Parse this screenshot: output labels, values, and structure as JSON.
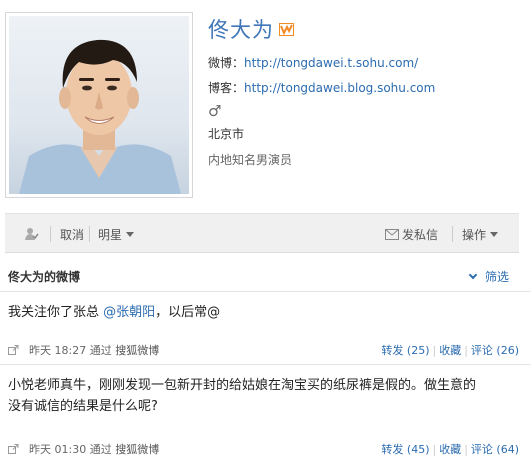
{
  "profile": {
    "name": "佟大为",
    "weibo_label": "微博：",
    "weibo_url": "http://tongdawei.t.sohu.com/",
    "blog_label": "博客：",
    "blog_url": "http://tongdawei.blog.sohu.com",
    "gender_symbol": "♂",
    "city": "北京市",
    "description": "内地知名男演员",
    "badge_color": "#f28c28"
  },
  "action_bar": {
    "unfollow_label": "取消",
    "group_label": "明星",
    "message_label": "发私信",
    "operate_label": "操作"
  },
  "section": {
    "title": "佟大为的微博",
    "filter_label": "筛选"
  },
  "posts": [
    {
      "text_before": "我关注你了张总 ",
      "mention": "@张朝阳",
      "text_after": "，以后常@",
      "time": "昨天 18:27",
      "via_prefix": "通过",
      "via_source": "搜狐微博",
      "repost": "转发 (25)",
      "favorite": "收藏",
      "comment": "评论 (26)"
    },
    {
      "line1": "小悦老师真牛，刚刚发现一包新开封的给姑娘在淘宝买的纸尿裤是假的。做生意的",
      "line2": "没有诚信的结果是什么呢?",
      "time": "昨天 01:30",
      "via_prefix": "通过",
      "via_source": "搜狐微博",
      "repost": "转发 (45)",
      "favorite": "收藏",
      "comment": "评论 (64)"
    }
  ]
}
